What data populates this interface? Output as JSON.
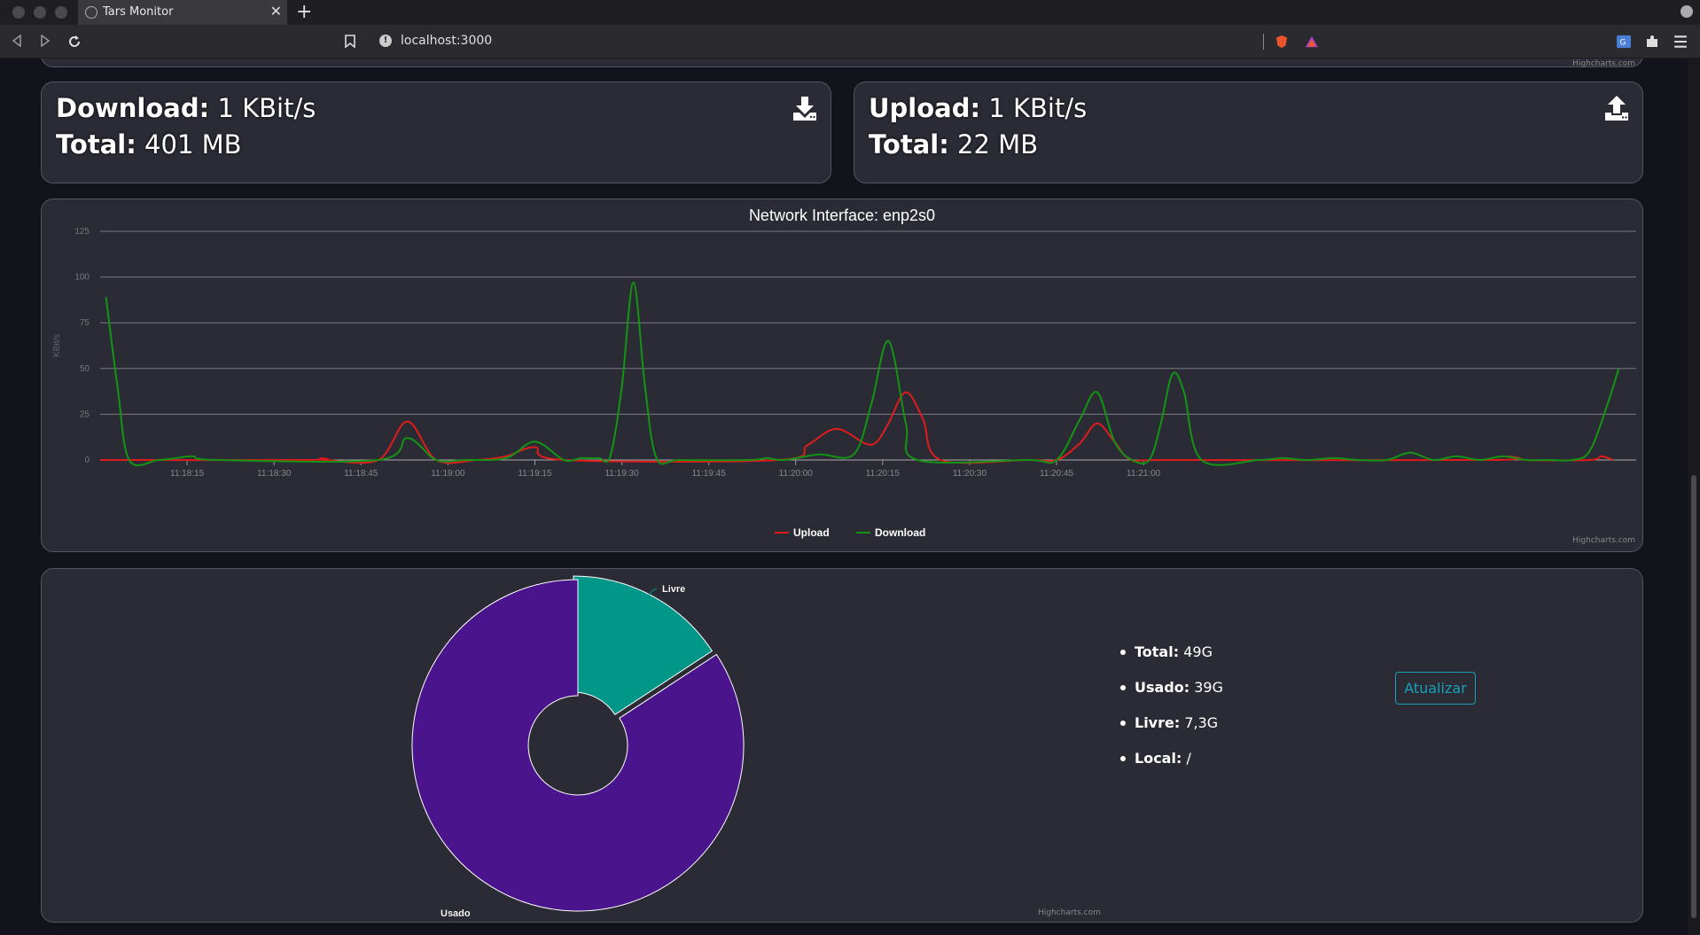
{
  "browser": {
    "tab_title": "Tars Monitor",
    "tab_close": "✕",
    "new_tab": "+",
    "address": "localhost:3000"
  },
  "download": {
    "label": "Download:",
    "rate": "1 KBit/s",
    "total_label": "Total:",
    "total": "401 MB"
  },
  "upload": {
    "label": "Upload:",
    "rate": "1 KBit/s",
    "total_label": "Total:",
    "total": "22 MB"
  },
  "credits": {
    "text": "Highcharts.com"
  },
  "network_chart": {
    "title": "Network Interface: enp2s0",
    "chart_data": {
      "type": "line",
      "title": "Network Interface: enp2s0",
      "ylabel": "KBit/s",
      "ylim": [
        0,
        125
      ],
      "yticks": [
        "0",
        "25",
        "50",
        "75",
        "100",
        "125"
      ],
      "xticks": [
        "11:18:15",
        "11:18:30",
        "11:18:45",
        "11:19:00",
        "11:19:15",
        "11:19:30",
        "11:19:45",
        "11:20:00",
        "11:20:15",
        "11:20:30",
        "11:20:45",
        "11:21:00"
      ],
      "legend": "bottom-center",
      "series": [
        {
          "name": "Upload",
          "color": "#e01b1b",
          "points": [
            [
              0,
              0
            ],
            [
              36,
              0
            ],
            [
              38,
              1
            ],
            [
              39,
              0
            ],
            [
              48,
              0
            ],
            [
              53,
              21
            ],
            [
              58,
              0
            ],
            [
              65,
              0
            ],
            [
              70,
              2
            ],
            [
              75,
              7
            ],
            [
              80,
              0
            ],
            [
              117,
              0
            ],
            [
              122,
              8
            ],
            [
              127,
              17
            ],
            [
              132,
              9
            ],
            [
              134,
              10
            ],
            [
              136,
              20
            ],
            [
              139,
              37
            ],
            [
              142,
              22
            ],
            [
              145,
              0
            ],
            [
              160,
              0
            ],
            [
              165,
              0
            ],
            [
              169,
              9
            ],
            [
              172,
              20
            ],
            [
              175,
              10
            ],
            [
              178,
              0
            ],
            [
              185,
              0
            ],
            [
              240,
              0
            ],
            [
              243,
              2
            ],
            [
              246,
              0
            ],
            [
              257,
              0
            ],
            [
              259,
              2
            ],
            [
              261,
              0
            ]
          ]
        },
        {
          "name": "Download",
          "color": "#149414",
          "points": [
            [
              1,
              89
            ],
            [
              3,
              40
            ],
            [
              5,
              0
            ],
            [
              10,
              0
            ],
            [
              13,
              1
            ],
            [
              16,
              2
            ],
            [
              20,
              0
            ],
            [
              48,
              0
            ],
            [
              53,
              12
            ],
            [
              58,
              0
            ],
            [
              63,
              0
            ],
            [
              70,
              1
            ],
            [
              75,
              10
            ],
            [
              80,
              0
            ],
            [
              83,
              1
            ],
            [
              86,
              1
            ],
            [
              88,
              2
            ],
            [
              90,
              40
            ],
            [
              92,
              97
            ],
            [
              94,
              40
            ],
            [
              96,
              1
            ],
            [
              100,
              0
            ],
            [
              112,
              0
            ],
            [
              115,
              1
            ],
            [
              118,
              0
            ],
            [
              124,
              3
            ],
            [
              130,
              3
            ],
            [
              133,
              30
            ],
            [
              136,
              65
            ],
            [
              139,
              20
            ],
            [
              141,
              0
            ],
            [
              160,
              0
            ],
            [
              165,
              0
            ],
            [
              169,
              22
            ],
            [
              172,
              37
            ],
            [
              175,
              10
            ],
            [
              178,
              0
            ],
            [
              181,
              0
            ],
            [
              183,
              20
            ],
            [
              185,
              47
            ],
            [
              187,
              37
            ],
            [
              190,
              0
            ],
            [
              200,
              0
            ],
            [
              204,
              1
            ],
            [
              208,
              0
            ],
            [
              213,
              1
            ],
            [
              217,
              0
            ],
            [
              222,
              0
            ],
            [
              226,
              4
            ],
            [
              230,
              0
            ],
            [
              234,
              2
            ],
            [
              238,
              0
            ],
            [
              242,
              2
            ],
            [
              246,
              0
            ],
            [
              250,
              0
            ],
            [
              254,
              0
            ],
            [
              257,
              5
            ],
            [
              260,
              30
            ],
            [
              262,
              50
            ]
          ]
        }
      ]
    }
  },
  "disk_chart": {
    "chart_data": {
      "type": "pie",
      "slices": [
        {
          "label": "Livre",
          "value": 7.3,
          "color": "#009688"
        },
        {
          "label": "Usado",
          "value": 39,
          "color": "#4a148c"
        }
      ]
    }
  },
  "disk": {
    "total_label": "Total:",
    "total": "49G",
    "used_label": "Usado:",
    "used": "39G",
    "free_label": "Livre:",
    "free": "7,3G",
    "local_label": "Local:",
    "local": "/"
  },
  "refresh_button": "Atualizar"
}
